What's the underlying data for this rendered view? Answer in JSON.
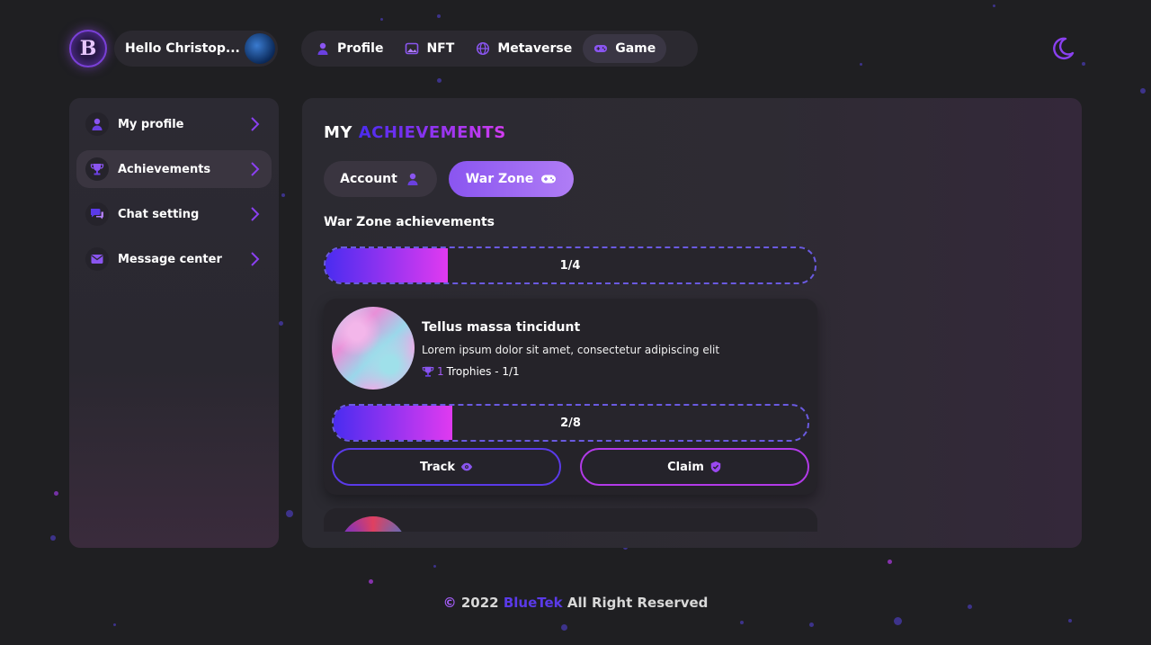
{
  "header": {
    "logo_letter": "B",
    "greeting": "Hello Christop...",
    "nav": [
      {
        "label": "Profile",
        "icon": "user-icon"
      },
      {
        "label": "NFT",
        "icon": "image-icon"
      },
      {
        "label": "Metaverse",
        "icon": "globe-icon"
      },
      {
        "label": "Game",
        "icon": "gamepad-icon",
        "active": true
      }
    ],
    "theme_icon": "moon-icon"
  },
  "sidebar": {
    "items": [
      {
        "label": "My profile",
        "icon": "user-icon"
      },
      {
        "label": "Achievements",
        "icon": "trophy-icon",
        "active": true
      },
      {
        "label": "Chat setting",
        "icon": "chat-icon"
      },
      {
        "label": "Message center",
        "icon": "mail-icon"
      }
    ]
  },
  "main": {
    "title_plain": "MY",
    "title_accent": "ACHIEVEMENTS",
    "tabs": [
      {
        "label": "Account",
        "icon": "user-icon"
      },
      {
        "label": "War Zone",
        "icon": "gamepad-icon",
        "active": true
      }
    ],
    "section_label": "War Zone achievements",
    "overall_progress": {
      "text": "1/4",
      "fraction": 0.25
    },
    "cards": [
      {
        "title": "Tellus massa tincidunt",
        "description": "Lorem ipsum dolor sit amet, consectetur adipiscing elit",
        "trophy_count": "1",
        "trophy_text": "Trophies - 1/1",
        "progress": {
          "text": "2/8",
          "fraction": 0.25
        },
        "track_label": "Track",
        "claim_label": "Claim"
      }
    ]
  },
  "footer": {
    "copyright_symbol": "©",
    "year": "2022",
    "brand": "BlueTek",
    "rest": "All Right Reserved"
  },
  "colors": {
    "accent_blue": "#4a2cf0",
    "accent_pink": "#e03af0",
    "accent_purple": "#a25cf5",
    "background": "#1f1f22"
  }
}
